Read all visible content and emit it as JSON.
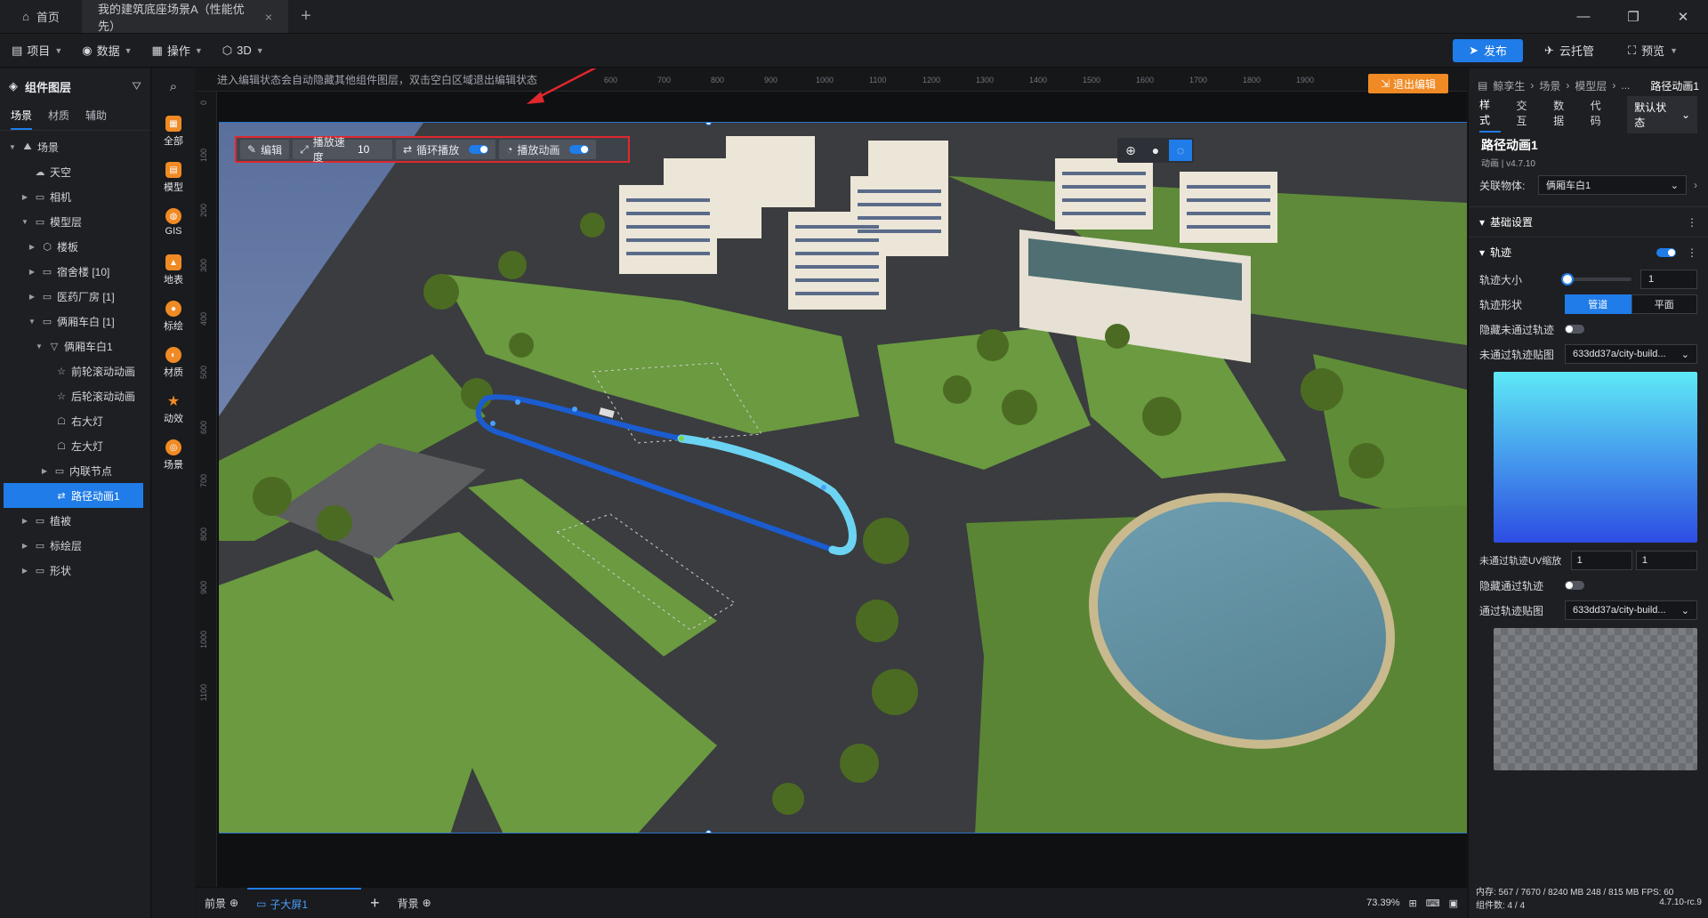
{
  "titlebar": {
    "home_label": "首页",
    "doc_tab_label": "我的建筑底座场景A（性能优先）",
    "close_glyph": "×",
    "add_glyph": "+"
  },
  "menubar": {
    "items": [
      "项目",
      "数据",
      "操作",
      "3D"
    ],
    "publish": "发布",
    "cloud": "云托管",
    "preview": "预览"
  },
  "layers": {
    "title": "组件图层",
    "tabs": [
      "场景",
      "材质",
      "辅助"
    ],
    "tree": [
      {
        "label": "场景"
      },
      {
        "label": "天空"
      },
      {
        "label": "相机"
      },
      {
        "label": "模型层"
      },
      {
        "label": "楼板"
      },
      {
        "label": "宿舍楼 [10]"
      },
      {
        "label": "医药厂房 [1]"
      },
      {
        "label": "俩厢车白 [1]"
      },
      {
        "label": "俩厢车白1"
      },
      {
        "label": "前轮滚动动画"
      },
      {
        "label": "后轮滚动动画"
      },
      {
        "label": "右大灯"
      },
      {
        "label": "左大灯"
      },
      {
        "label": "内联节点"
      },
      {
        "label": "路径动画1"
      },
      {
        "label": "植被"
      },
      {
        "label": "标绘层"
      },
      {
        "label": "形状"
      }
    ]
  },
  "iconbar": {
    "items": [
      "全部",
      "模型",
      "GIS",
      "地表",
      "标绘",
      "材质",
      "动效",
      "场景"
    ]
  },
  "canvas": {
    "hint": "进入编辑状态会自动隐藏其他组件图层，双击空白区域退出编辑状态",
    "exit_edit": "退出编辑",
    "ruler_top": [
      "600",
      "700",
      "800",
      "900",
      "1000",
      "1100",
      "1200",
      "1300",
      "1400",
      "1500",
      "1600",
      "1700",
      "1800",
      "1900"
    ],
    "ruler_left": [
      "0",
      "100",
      "200",
      "300",
      "400",
      "500",
      "600",
      "700",
      "800",
      "900",
      "1000",
      "1100"
    ],
    "toolbar": {
      "edit": "编辑",
      "speed_label": "播放速度",
      "speed_value": "10",
      "loop_label": "循环播放",
      "loop_on": true,
      "play_label": "播放动画",
      "play_on": true
    }
  },
  "bottombar": {
    "foreground": "前景",
    "sub_screen": "子大屏1",
    "background": "背景",
    "zoom": "73.39%"
  },
  "props": {
    "breadcrumb": [
      "鲸孪生",
      "场景",
      "模型层",
      "..."
    ],
    "current": "路径动画1",
    "tabs": [
      "样式",
      "交互",
      "数据",
      "代码"
    ],
    "state": "默认状态",
    "name": "路径动画1",
    "subtitle": "动画 | v4.7.10",
    "related_label": "关联物体:",
    "related_value": "俩厢车白1",
    "section_basic": "基础设置",
    "section_track": "轨迹",
    "track_enabled": true,
    "track_size_label": "轨迹大小",
    "track_size_value": "1",
    "track_size_level": 0,
    "track_shape_label": "轨迹形状",
    "track_shape_options": [
      "管道",
      "平面"
    ],
    "track_shape_selected": "管道",
    "hide_unpassed_label": "隐藏未通过轨迹",
    "hide_unpassed_on": false,
    "unpassed_tex_label": "未通过轨迹贴图",
    "unpassed_tex_value": "633dd37a/city-build...",
    "uv_label": "未通过轨迹UV缩放",
    "uv_x": "1",
    "uv_y": "1",
    "hide_passed_label": "隐藏通过轨迹",
    "hide_passed_on": false,
    "passed_tex_label": "通过轨迹贴图",
    "passed_tex_value": "633dd37a/city-build...",
    "memory": "内存: 567 / 7670 / 8240 MB 248 / 815 MB FPS: 60",
    "components": "组件数: 4 / 4",
    "version": "4.7.10-rc.9"
  }
}
